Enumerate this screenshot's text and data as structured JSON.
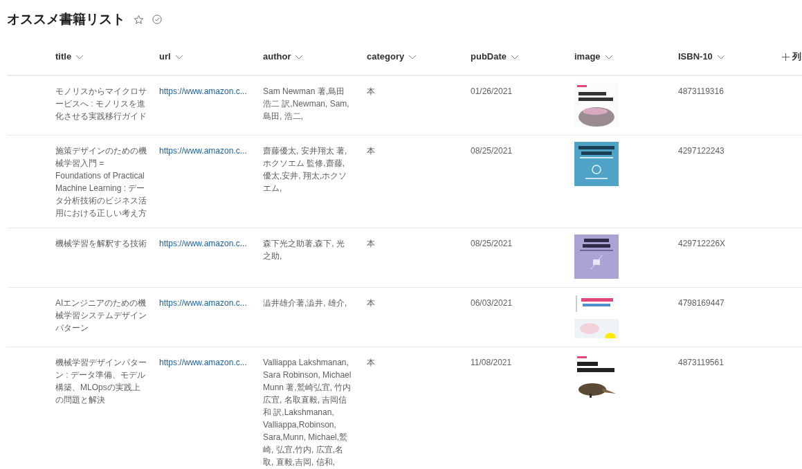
{
  "title": "オススメ書籍リスト",
  "favorite": false,
  "columns": [
    {
      "label": "title"
    },
    {
      "label": "url"
    },
    {
      "label": "author"
    },
    {
      "label": "category"
    },
    {
      "label": "pubDate"
    },
    {
      "label": "image"
    },
    {
      "label": "ISBN-10"
    }
  ],
  "add_column": "列",
  "rows": [
    {
      "title": "モノリスからマイクロサービスへ : モノリスを進化させる実践移行ガイド",
      "url": "https://www.amazon.c...",
      "author": "Sam Newman 著,島田浩二 訳,Newman, Sam,島田, 浩二,",
      "category": "本",
      "pubDate": "01/26/2021",
      "isbn": "4873119316"
    },
    {
      "title": "施策デザインのための機械学習入門 = Foundations of Practical Machine Learning : データ分析技術のビジネス活用における正しい考え方",
      "url": "https://www.amazon.c...",
      "author": "齋藤優太, 安井翔太 著, ホクソエム 監修,齋藤, 優太,安井, 翔太,ホクソエム,",
      "category": "本",
      "pubDate": "08/25/2021",
      "isbn": "4297122243"
    },
    {
      "title": "機械学習を解釈する技術",
      "url": "https://www.amazon.c...",
      "author": "森下光之助著,森下, 光之助,",
      "category": "本",
      "pubDate": "08/25/2021",
      "isbn": "429712226X"
    },
    {
      "title": "AIエンジニアのための機械学習システムデザインパターン",
      "url": "https://www.amazon.c...",
      "author": "澁井雄介著,澁井, 雄介,",
      "category": "本",
      "pubDate": "06/03/2021",
      "isbn": "4798169447"
    },
    {
      "title": "機械学習デザインパターン : データ準備、モデル構築、MLOpsの実践上の問題と解決",
      "url": "https://www.amazon.c...",
      "author": "Valliappa Lakshmanan, Sara Robinson, Michael Munn 著,鷲崎弘宜, 竹内広宜, 名取直毅, 吉岡信和 訳,Lakshmanan, Valliappa,Robinson, Sara,Munn, Michael,鷲崎, 弘宜,竹内, 広宜,名取, 直毅,吉岡, 信和,",
      "category": "本",
      "pubDate": "11/08/2021",
      "isbn": "4873119561"
    }
  ]
}
